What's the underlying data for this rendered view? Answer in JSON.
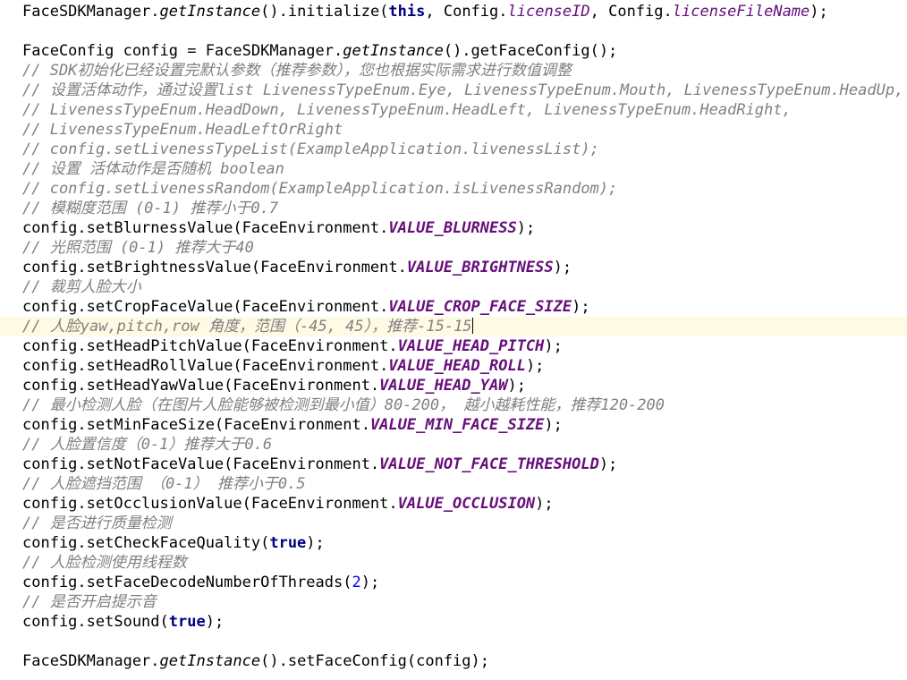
{
  "editor": {
    "language": "java",
    "colors": {
      "background": "#ffffff",
      "default": "#000000",
      "comment": "#808080",
      "keyword": "#000080",
      "static_field": "#660e7a",
      "number": "#0000ff",
      "current_line": "#fffae3"
    },
    "current_line_index": 16,
    "caret_after_line_index": 16,
    "lines": [
      {
        "kind": "code",
        "tokens": [
          [
            "",
            "FaceSDKManager."
          ],
          [
            "method",
            "getInstance"
          ],
          [
            "",
            "().initialize("
          ],
          [
            "kw",
            "this"
          ],
          [
            "",
            ", Config."
          ],
          [
            "field",
            "licenseID"
          ],
          [
            "",
            ", Config."
          ],
          [
            "field",
            "licenseFileName"
          ],
          [
            "",
            ");"
          ]
        ]
      },
      {
        "kind": "blank",
        "tokens": []
      },
      {
        "kind": "code",
        "tokens": [
          [
            "",
            "FaceConfig config = FaceSDKManager."
          ],
          [
            "method",
            "getInstance"
          ],
          [
            "",
            "().getFaceConfig();"
          ]
        ]
      },
      {
        "kind": "comment",
        "tokens": [
          [
            "comment",
            "// SDK初始化已经设置完默认参数（推荐参数），您也根据实际需求进行数值调整"
          ]
        ]
      },
      {
        "kind": "comment",
        "tokens": [
          [
            "comment",
            "// 设置活体动作，通过设置list LivenessTypeEnum.Eye, LivenessTypeEnum.Mouth, LivenessTypeEnum.HeadUp,"
          ]
        ]
      },
      {
        "kind": "comment",
        "tokens": [
          [
            "comment",
            "// LivenessTypeEnum.HeadDown, LivenessTypeEnum.HeadLeft, LivenessTypeEnum.HeadRight,"
          ]
        ]
      },
      {
        "kind": "comment",
        "tokens": [
          [
            "comment",
            "// LivenessTypeEnum.HeadLeftOrRight"
          ]
        ]
      },
      {
        "kind": "comment",
        "tokens": [
          [
            "comment",
            "// config.setLivenessTypeList(ExampleApplication.livenessList);"
          ]
        ]
      },
      {
        "kind": "comment",
        "tokens": [
          [
            "comment",
            "// 设置 活体动作是否随机 boolean"
          ]
        ]
      },
      {
        "kind": "comment",
        "tokens": [
          [
            "comment",
            "// config.setLivenessRandom(ExampleApplication.isLivenessRandom);"
          ]
        ]
      },
      {
        "kind": "comment",
        "tokens": [
          [
            "comment",
            "// 模糊度范围 (0-1) 推荐小于0.7"
          ]
        ]
      },
      {
        "kind": "code",
        "tokens": [
          [
            "",
            "config.setBlurnessValue(FaceEnvironment."
          ],
          [
            "static",
            "VALUE_BLURNESS"
          ],
          [
            "",
            ");"
          ]
        ]
      },
      {
        "kind": "comment",
        "tokens": [
          [
            "comment",
            "// 光照范围 (0-1) 推荐大于40"
          ]
        ]
      },
      {
        "kind": "code",
        "tokens": [
          [
            "",
            "config.setBrightnessValue(FaceEnvironment."
          ],
          [
            "static",
            "VALUE_BRIGHTNESS"
          ],
          [
            "",
            ");"
          ]
        ]
      },
      {
        "kind": "comment",
        "tokens": [
          [
            "comment",
            "// 裁剪人脸大小"
          ]
        ]
      },
      {
        "kind": "code",
        "tokens": [
          [
            "",
            "config.setCropFaceValue(FaceEnvironment."
          ],
          [
            "static",
            "VALUE_CROP_FACE_SIZE"
          ],
          [
            "",
            ");"
          ]
        ]
      },
      {
        "kind": "comment",
        "tokens": [
          [
            "comment",
            "// 人脸yaw,pitch,row 角度，范围（-45, 45），推荐-15-15"
          ]
        ]
      },
      {
        "kind": "code",
        "tokens": [
          [
            "",
            "config.setHeadPitchValue(FaceEnvironment."
          ],
          [
            "static",
            "VALUE_HEAD_PITCH"
          ],
          [
            "",
            ");"
          ]
        ]
      },
      {
        "kind": "code",
        "tokens": [
          [
            "",
            "config.setHeadRollValue(FaceEnvironment."
          ],
          [
            "static",
            "VALUE_HEAD_ROLL"
          ],
          [
            "",
            ");"
          ]
        ]
      },
      {
        "kind": "code",
        "tokens": [
          [
            "",
            "config.setHeadYawValue(FaceEnvironment."
          ],
          [
            "static",
            "VALUE_HEAD_YAW"
          ],
          [
            "",
            ");"
          ]
        ]
      },
      {
        "kind": "comment",
        "tokens": [
          [
            "comment",
            "// 最小检测人脸（在图片人脸能够被检测到最小值）80-200， 越小越耗性能，推荐120-200"
          ]
        ]
      },
      {
        "kind": "code",
        "tokens": [
          [
            "",
            "config.setMinFaceSize(FaceEnvironment."
          ],
          [
            "static",
            "VALUE_MIN_FACE_SIZE"
          ],
          [
            "",
            ");"
          ]
        ]
      },
      {
        "kind": "comment",
        "tokens": [
          [
            "comment",
            "// 人脸置信度（0-1）推荐大于0.6"
          ]
        ]
      },
      {
        "kind": "code",
        "tokens": [
          [
            "",
            "config.setNotFaceValue(FaceEnvironment."
          ],
          [
            "static",
            "VALUE_NOT_FACE_THRESHOLD"
          ],
          [
            "",
            ");"
          ]
        ]
      },
      {
        "kind": "comment",
        "tokens": [
          [
            "comment",
            "// 人脸遮挡范围 （0-1） 推荐小于0.5"
          ]
        ]
      },
      {
        "kind": "code",
        "tokens": [
          [
            "",
            "config.setOcclusionValue(FaceEnvironment."
          ],
          [
            "static",
            "VALUE_OCCLUSION"
          ],
          [
            "",
            ");"
          ]
        ]
      },
      {
        "kind": "comment",
        "tokens": [
          [
            "comment",
            "// 是否进行质量检测"
          ]
        ]
      },
      {
        "kind": "code",
        "tokens": [
          [
            "",
            "config.setCheckFaceQuality("
          ],
          [
            "kw",
            "true"
          ],
          [
            "",
            ");"
          ]
        ]
      },
      {
        "kind": "comment",
        "tokens": [
          [
            "comment",
            "// 人脸检测使用线程数"
          ]
        ]
      },
      {
        "kind": "code",
        "tokens": [
          [
            "",
            "config.setFaceDecodeNumberOfThreads("
          ],
          [
            "num",
            "2"
          ],
          [
            "",
            ");"
          ]
        ]
      },
      {
        "kind": "comment",
        "tokens": [
          [
            "comment",
            "// 是否开启提示音"
          ]
        ]
      },
      {
        "kind": "code",
        "tokens": [
          [
            "",
            "config.setSound("
          ],
          [
            "kw",
            "true"
          ],
          [
            "",
            ");"
          ]
        ]
      },
      {
        "kind": "blank",
        "tokens": []
      },
      {
        "kind": "code",
        "tokens": [
          [
            "",
            "FaceSDKManager."
          ],
          [
            "method",
            "getInstance"
          ],
          [
            "",
            "().setFaceConfig(config);"
          ]
        ]
      }
    ]
  }
}
